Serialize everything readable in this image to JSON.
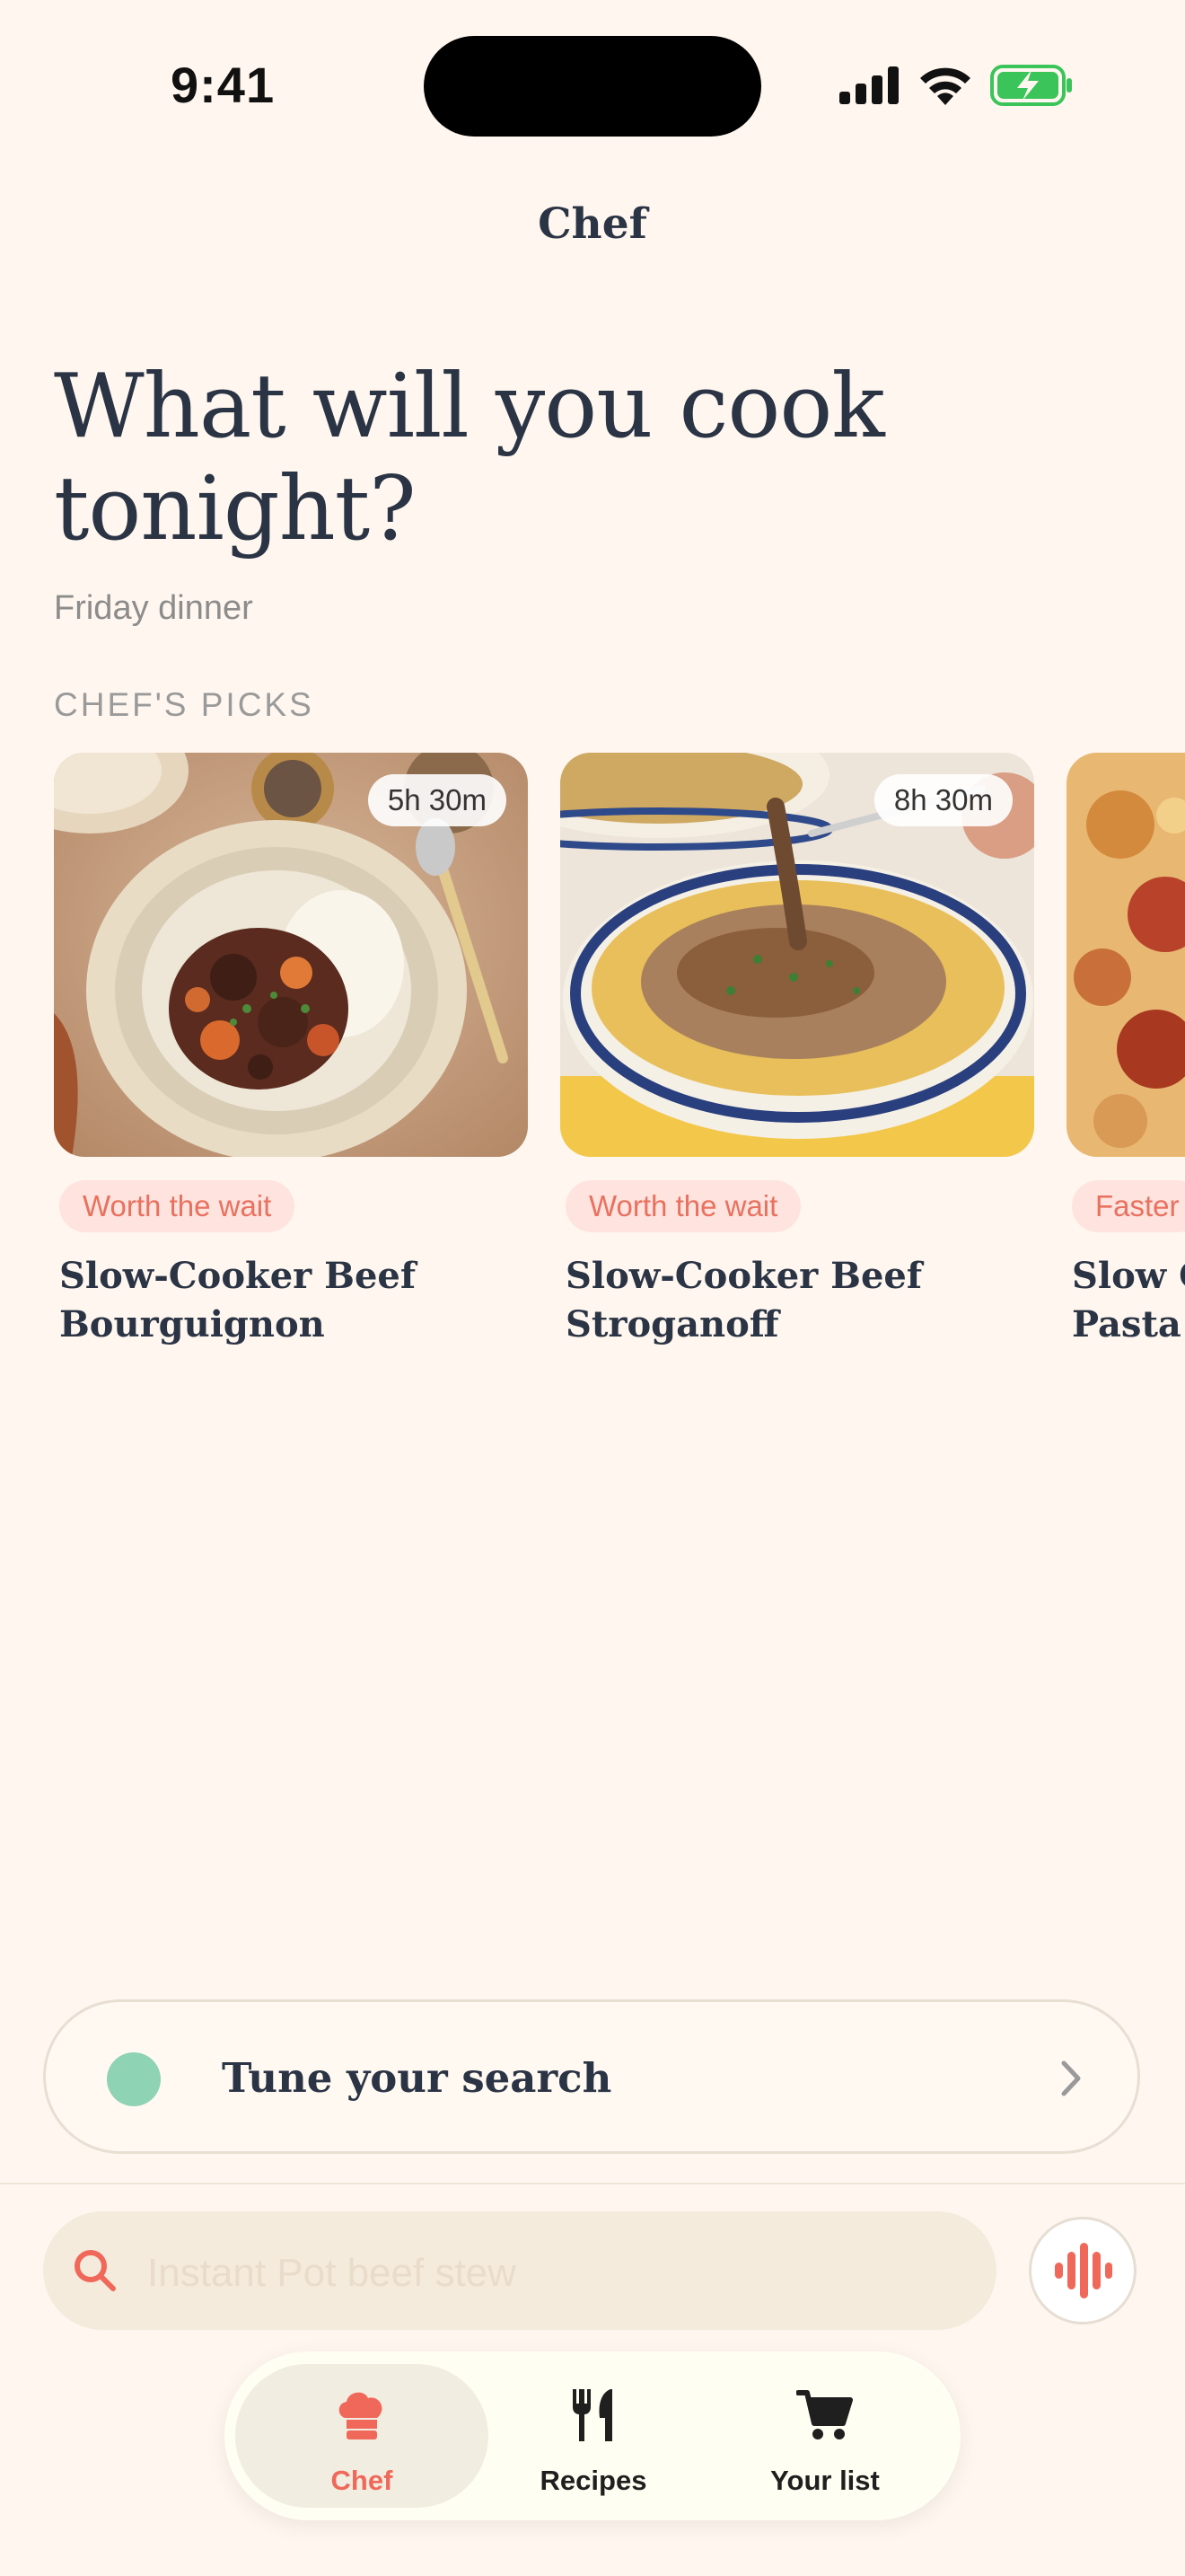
{
  "status_bar": {
    "time": "9:41"
  },
  "header": {
    "title": "Chef"
  },
  "hero": {
    "headline": "What will you cook tonight?",
    "subtitle": "Friday dinner"
  },
  "picks": {
    "section_label": "CHEF'S PICKS",
    "cards": [
      {
        "title": "Slow-Cooker Beef Bourguignon",
        "tag": "Worth the wait",
        "duration": "5h 30m"
      },
      {
        "title": "Slow-Cooker Beef Stroganoff",
        "tag": "Worth the wait",
        "duration": "8h 30m"
      },
      {
        "title": "Slow C… Pasta",
        "title_line1": "Slow C",
        "title_line2": "Pasta",
        "tag": "Faster"
      }
    ]
  },
  "tune": {
    "label": "Tune your search"
  },
  "search": {
    "placeholder": "Instant Pot beef stew"
  },
  "tabs": [
    {
      "label": "Chef",
      "icon": "chef-hat-icon",
      "active": true
    },
    {
      "label": "Recipes",
      "icon": "fork-knife-icon",
      "active": false
    },
    {
      "label": "Your list",
      "icon": "cart-icon",
      "active": false
    }
  ],
  "colors": {
    "background": "#FFF7EF",
    "accent": "#F0685A",
    "tag_bg": "#FFE3DE",
    "tag_text": "#E8715F",
    "tune_dot": "#8ED3B3",
    "battery": "#3BC45A"
  }
}
